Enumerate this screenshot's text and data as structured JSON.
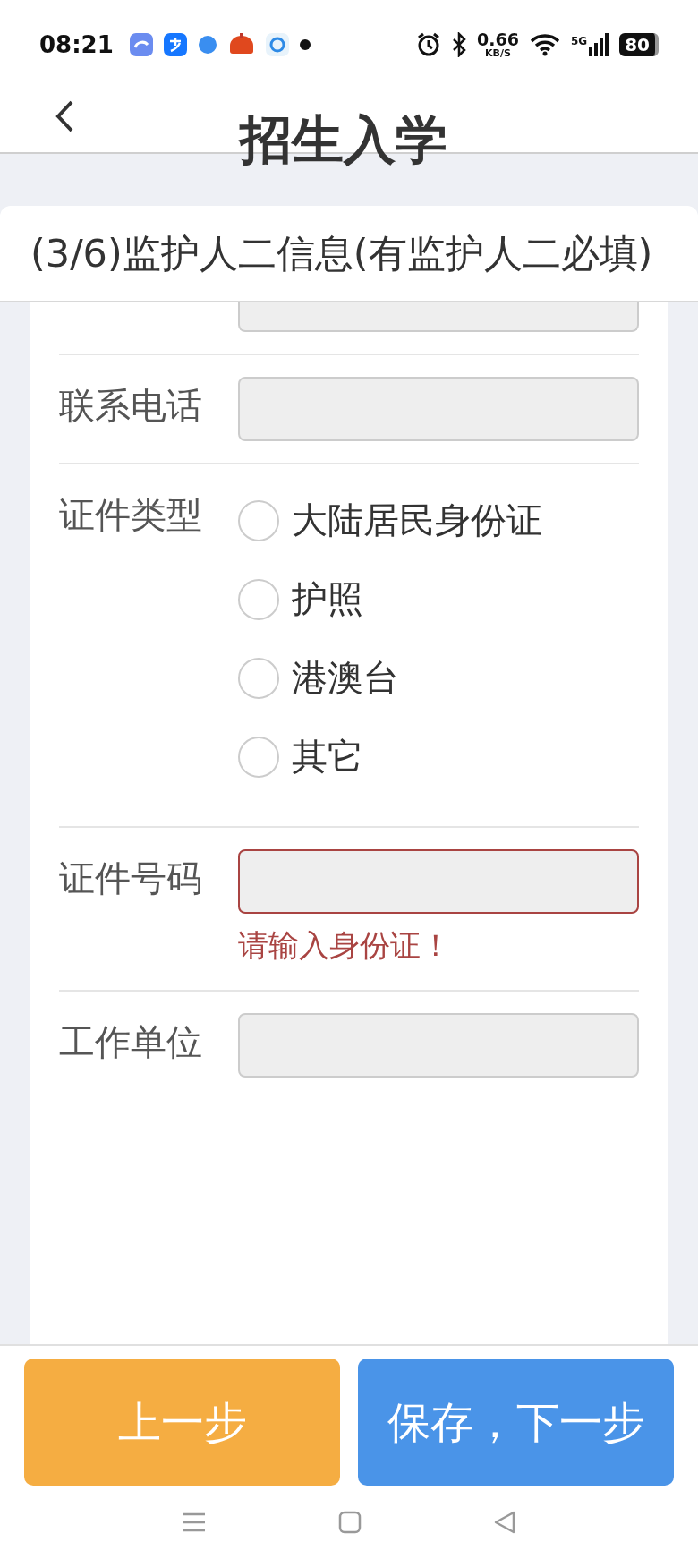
{
  "status_bar": {
    "time": "08:21",
    "net_speed": "0.66",
    "net_unit": "KB/S",
    "network": "5G",
    "battery": "80"
  },
  "header": {
    "title": "招生入学"
  },
  "section": {
    "title": "(3/6)监护人二信息(有监护人二必填)"
  },
  "form": {
    "fields": [
      {
        "kind": "partial_input",
        "invalid": false
      },
      {
        "kind": "input",
        "label": "联系电话",
        "invalid": false
      },
      {
        "kind": "radio",
        "label": "证件类型",
        "options": [
          {
            "label": "大陆居民身份证",
            "selected": false
          },
          {
            "label": "护照",
            "selected": false
          },
          {
            "label": "港澳台",
            "selected": false
          },
          {
            "label": "其它",
            "selected": false
          }
        ]
      },
      {
        "kind": "input",
        "label": "证件号码",
        "invalid": true,
        "error": "请输入身份证！"
      },
      {
        "kind": "input",
        "label": "工作单位",
        "invalid": false
      }
    ]
  },
  "buttons": [
    {
      "label": "上一步",
      "kind": "secondary"
    },
    {
      "label": "保存，下一步",
      "kind": "primary"
    }
  ]
}
